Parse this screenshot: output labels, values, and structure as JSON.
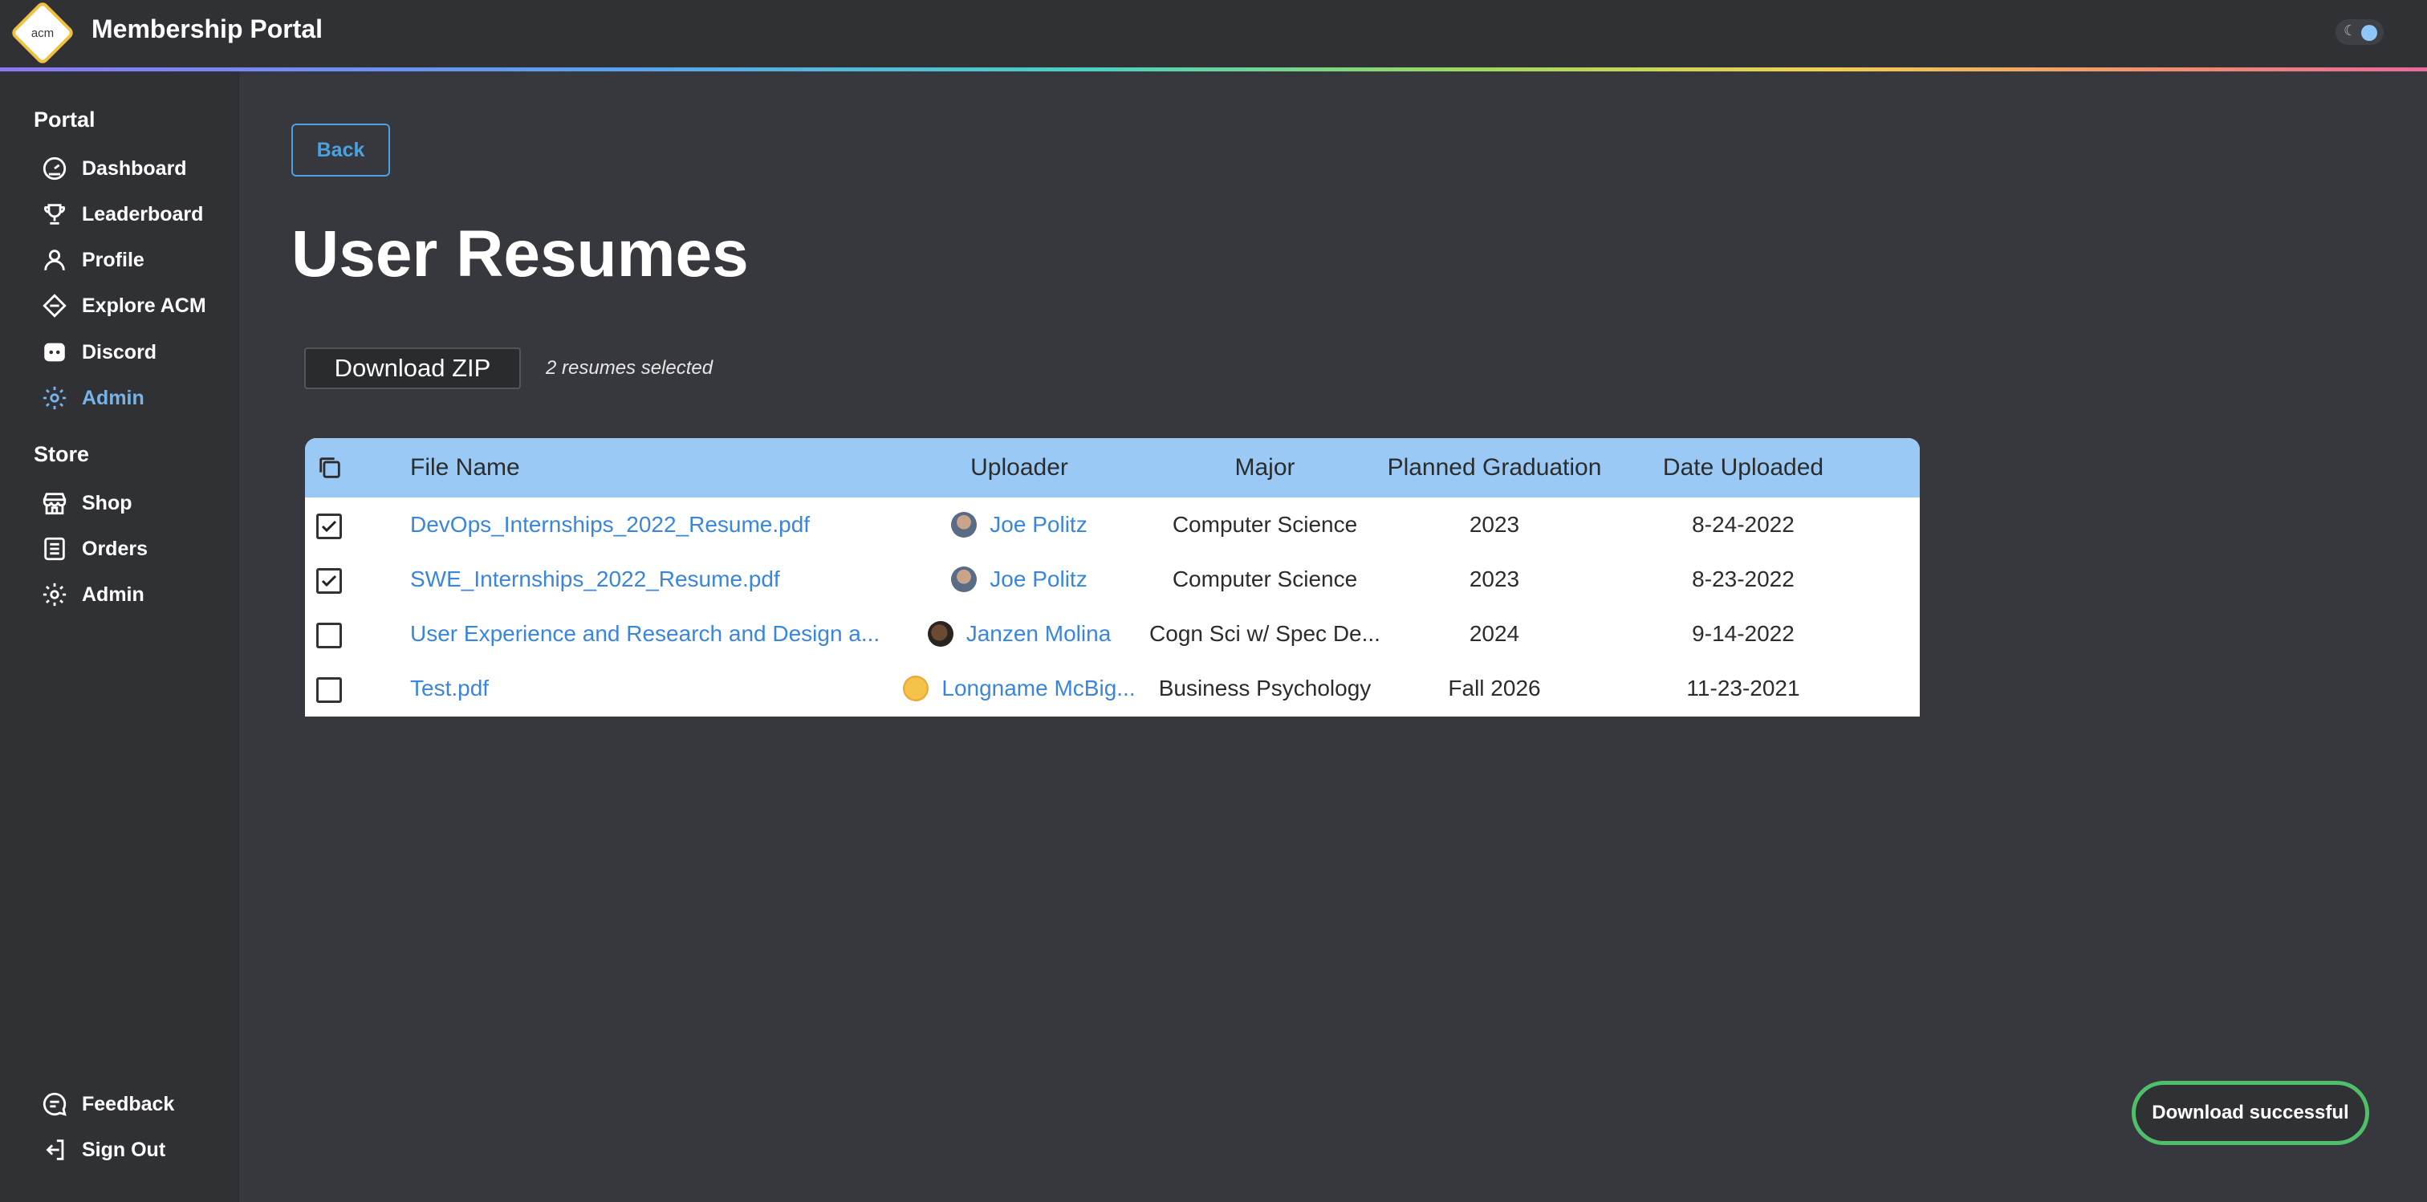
{
  "app": {
    "logo_text": "acm",
    "title": "Membership Portal"
  },
  "sidebar": {
    "portal_heading": "Portal",
    "portal_items": [
      {
        "label": "Dashboard",
        "icon": "dashboard-gauge-icon"
      },
      {
        "label": "Leaderboard",
        "icon": "trophy-icon"
      },
      {
        "label": "Profile",
        "icon": "user-icon"
      },
      {
        "label": "Explore ACM",
        "icon": "diamond-icon"
      },
      {
        "label": "Discord",
        "icon": "discord-icon"
      },
      {
        "label": "Admin",
        "icon": "gear-icon",
        "active": true
      }
    ],
    "store_heading": "Store",
    "store_items": [
      {
        "label": "Shop",
        "icon": "store-icon"
      },
      {
        "label": "Orders",
        "icon": "list-icon"
      },
      {
        "label": "Admin",
        "icon": "gear-icon"
      }
    ],
    "bottom_items": [
      {
        "label": "Feedback",
        "icon": "chat-bubble-icon"
      },
      {
        "label": "Sign Out",
        "icon": "sign-out-icon"
      }
    ]
  },
  "main": {
    "back_label": "Back",
    "title": "User Resumes",
    "download_zip_label": "Download ZIP",
    "selection_status": "2 resumes selected"
  },
  "table": {
    "columns": [
      "File Name",
      "Uploader",
      "Major",
      "Planned Graduation",
      "Date Uploaded"
    ],
    "rows": [
      {
        "checked": true,
        "file": "DevOps_Internships_2022_Resume.pdf",
        "uploader": "Joe Politz",
        "major": "Computer Science",
        "graduation": "2023",
        "date": "8-24-2022"
      },
      {
        "checked": true,
        "file": "SWE_Internships_2022_Resume.pdf",
        "uploader": "Joe Politz",
        "major": "Computer Science",
        "graduation": "2023",
        "date": "8-23-2022"
      },
      {
        "checked": false,
        "file": "User Experience and Research and Design a...",
        "uploader": "Janzen Molina",
        "major": "Cogn Sci w/ Spec De...",
        "graduation": "2024",
        "date": "9-14-2022"
      },
      {
        "checked": false,
        "file": "Test.pdf",
        "uploader": "Longname McBig...",
        "major": "Business Psychology",
        "graduation": "Fall 2026",
        "date": "11-23-2021"
      }
    ]
  },
  "toast": {
    "message": "Download successful"
  },
  "colors": {
    "accent": "#4aa3df",
    "active_nav": "#76b3e8",
    "table_header": "#99c9f4",
    "link": "#3a86dc",
    "toast_border": "#4fbf6a"
  }
}
